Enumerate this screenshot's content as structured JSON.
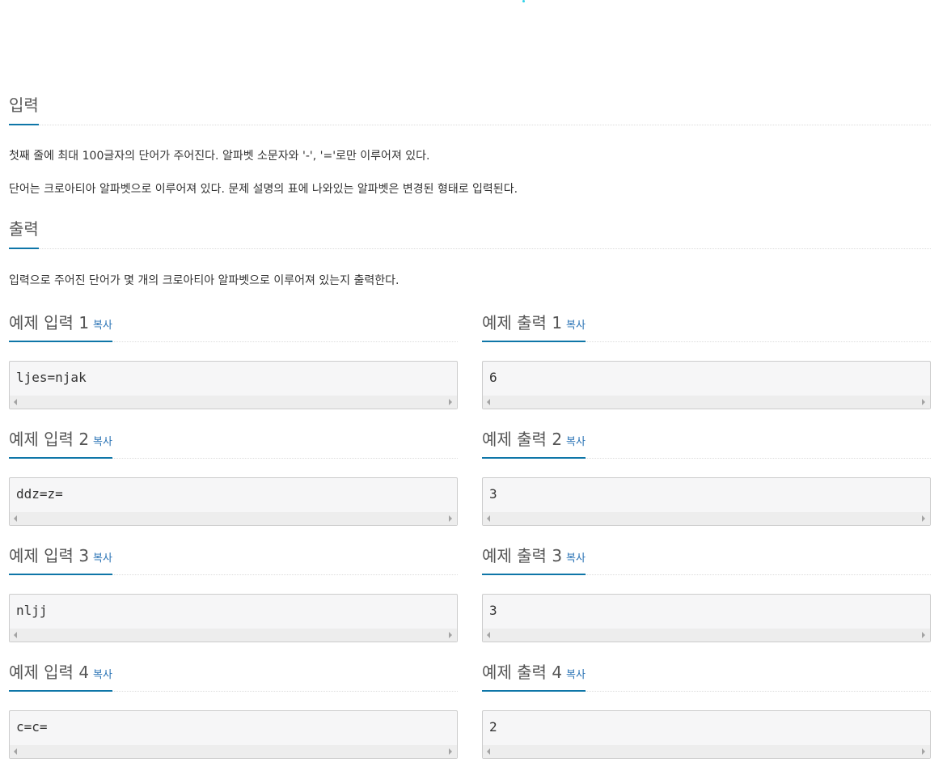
{
  "input": {
    "heading": "입력",
    "lines": [
      "첫째 줄에 최대 100글자의 단어가 주어진다. 알파벳 소문자와 '-', '='로만 이루어져 있다.",
      "단어는 크로아티아 알파벳으로 이루어져 있다. 문제 설명의 표에 나와있는 알파벳은 변경된 형태로 입력된다."
    ]
  },
  "output": {
    "heading": "출력",
    "line": "입력으로 주어진 단어가 몇 개의 크로아티아 알파벳으로 이루어져 있는지 출력한다."
  },
  "copy_label": "복사",
  "samples": [
    {
      "input_title": "예제 입력 1",
      "input": "ljes=njak",
      "output_title": "예제 출력 1",
      "output": "6"
    },
    {
      "input_title": "예제 입력 2",
      "input": "ddz=z=",
      "output_title": "예제 출력 2",
      "output": "3"
    },
    {
      "input_title": "예제 입력 3",
      "input": "nljj",
      "output_title": "예제 출력 3",
      "output": "3"
    },
    {
      "input_title": "예제 입력 4",
      "input": "c=c=",
      "output_title": "예제 출력 4",
      "output": "2"
    }
  ],
  "colors": {
    "accent_underline": "#0e76a8",
    "copy_link": "#2b74b6",
    "code_background": "#f6f6f7"
  }
}
